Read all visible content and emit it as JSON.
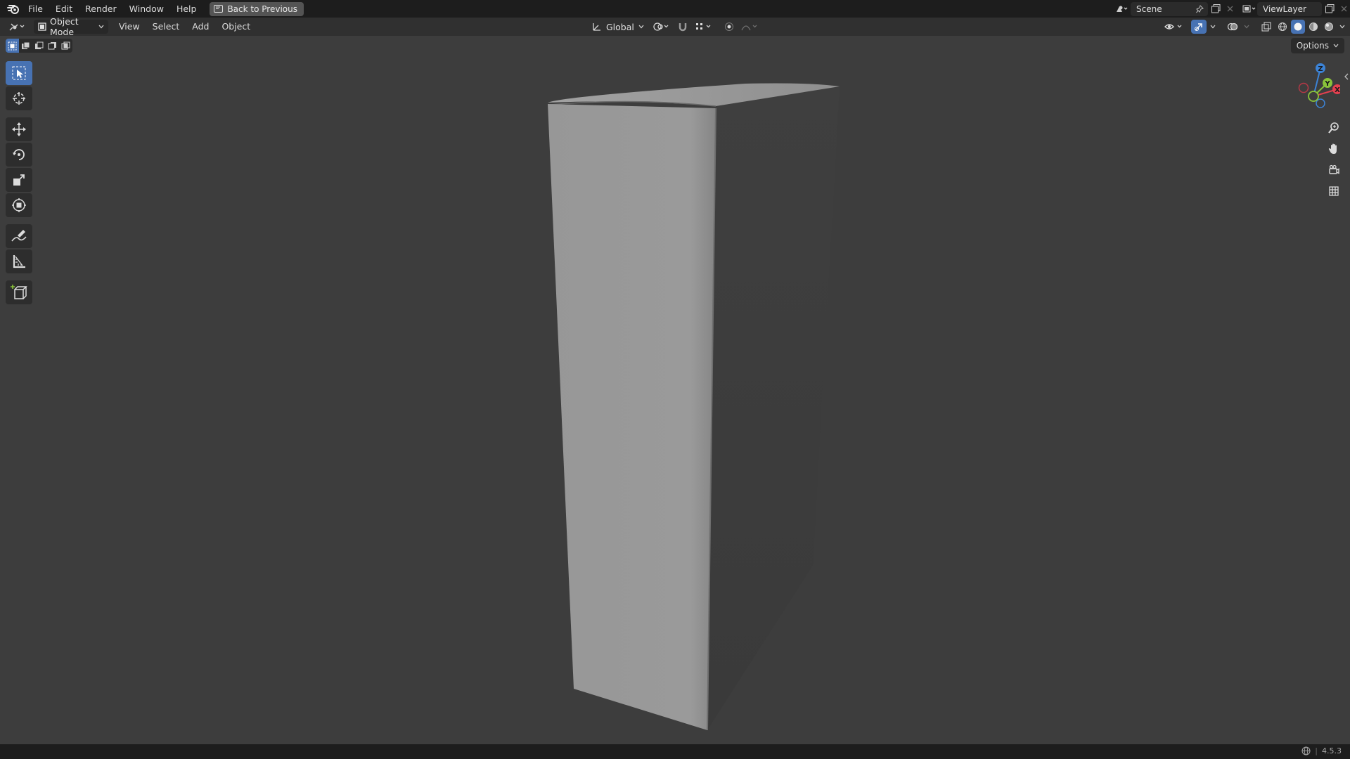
{
  "menu": {
    "items": [
      "File",
      "Edit",
      "Render",
      "Window",
      "Help"
    ],
    "back_button": "Back to Previous"
  },
  "scene": {
    "label": "Scene"
  },
  "view_layer": {
    "label": "ViewLayer"
  },
  "header": {
    "mode": "Object Mode",
    "menus": [
      "View",
      "Select",
      "Add",
      "Object"
    ],
    "transform_orientation": "Global"
  },
  "viewport": {
    "options_label": "Options",
    "gizmo_axes": {
      "z": "Z",
      "y": "Y",
      "x": "X"
    }
  },
  "tools": [
    "select-box",
    "cursor",
    "move",
    "rotate",
    "scale",
    "transform",
    "annotate",
    "measure",
    "add-cube"
  ],
  "status": {
    "version": "4.5.3"
  },
  "colors": {
    "accent": "#4772b3",
    "axis_x": "#e5404f",
    "axis_y": "#8ac43a",
    "axis_z": "#3c83d6"
  }
}
